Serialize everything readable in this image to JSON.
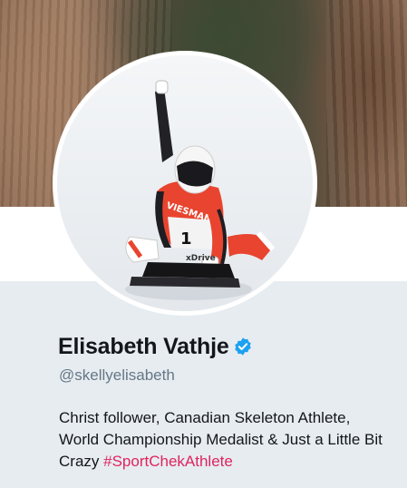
{
  "profile": {
    "name": "Elisabeth Vathje",
    "handle": "@skellyelisabeth",
    "verified": true,
    "bio": {
      "text": "Christ follower, Canadian Skeleton Athlete, World Championship Medalist & Just a Little Bit Crazy",
      "hashtag": "#SportChekAthlete"
    },
    "avatar": {
      "sponsor": "VIESMANN",
      "bib_number": "1",
      "sled_sponsor": "xDrive"
    }
  },
  "colors": {
    "background": "#e6ecf0",
    "name_text": "#14171a",
    "handle_text": "#657786",
    "verified_badge": "#1da1f2",
    "hashtag": "#e0245e",
    "suit_red": "#e8442f"
  },
  "icons": {
    "verified": "verified-badge-icon"
  }
}
